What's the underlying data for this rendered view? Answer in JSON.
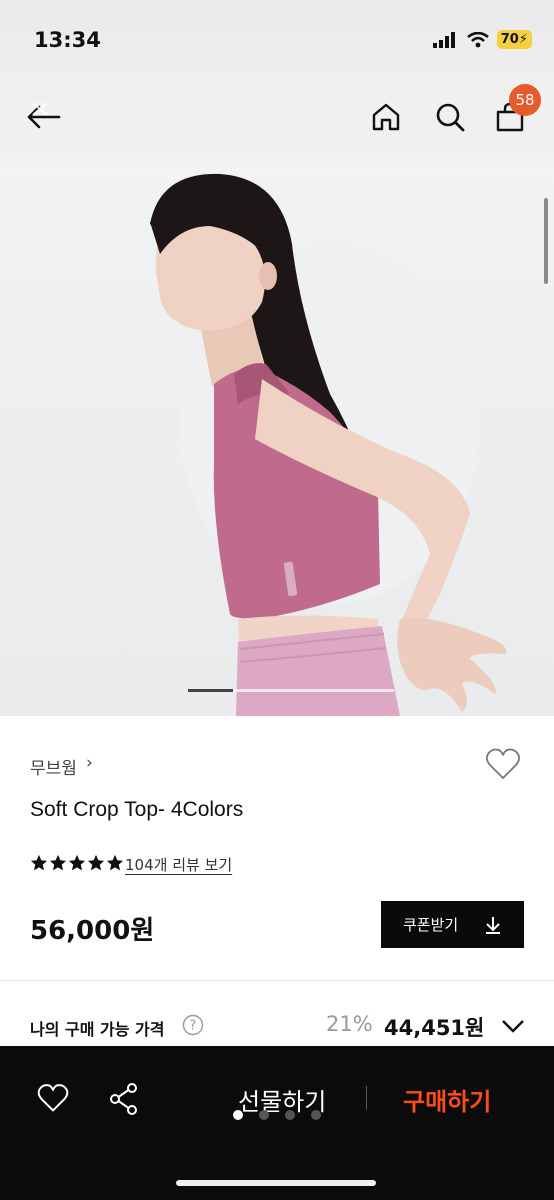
{
  "status": {
    "time": "13:34",
    "battery": "70"
  },
  "nav": {
    "cart_count": "58"
  },
  "product": {
    "brand": "무브웜",
    "brand_chevron": "›",
    "name": "Soft Crop Top- 4Colors",
    "rating_stars": 5,
    "review_link": "104개 리뷰 보기",
    "price": "56,000원",
    "coupon_label": "쿠폰받기",
    "my_price_label": "나의 구매 가능 가격",
    "discount": "21%",
    "final_price": "44,451원"
  },
  "gallery": {
    "current_fraction": 0.22
  },
  "bottom": {
    "gift_label": "선물하기",
    "buy_label": "구매하기",
    "dots": 4,
    "active_dot": 0
  },
  "colors": {
    "accent": "#ff4d1a",
    "badge": "#e65a2e",
    "top_color": "#c06b8c"
  }
}
